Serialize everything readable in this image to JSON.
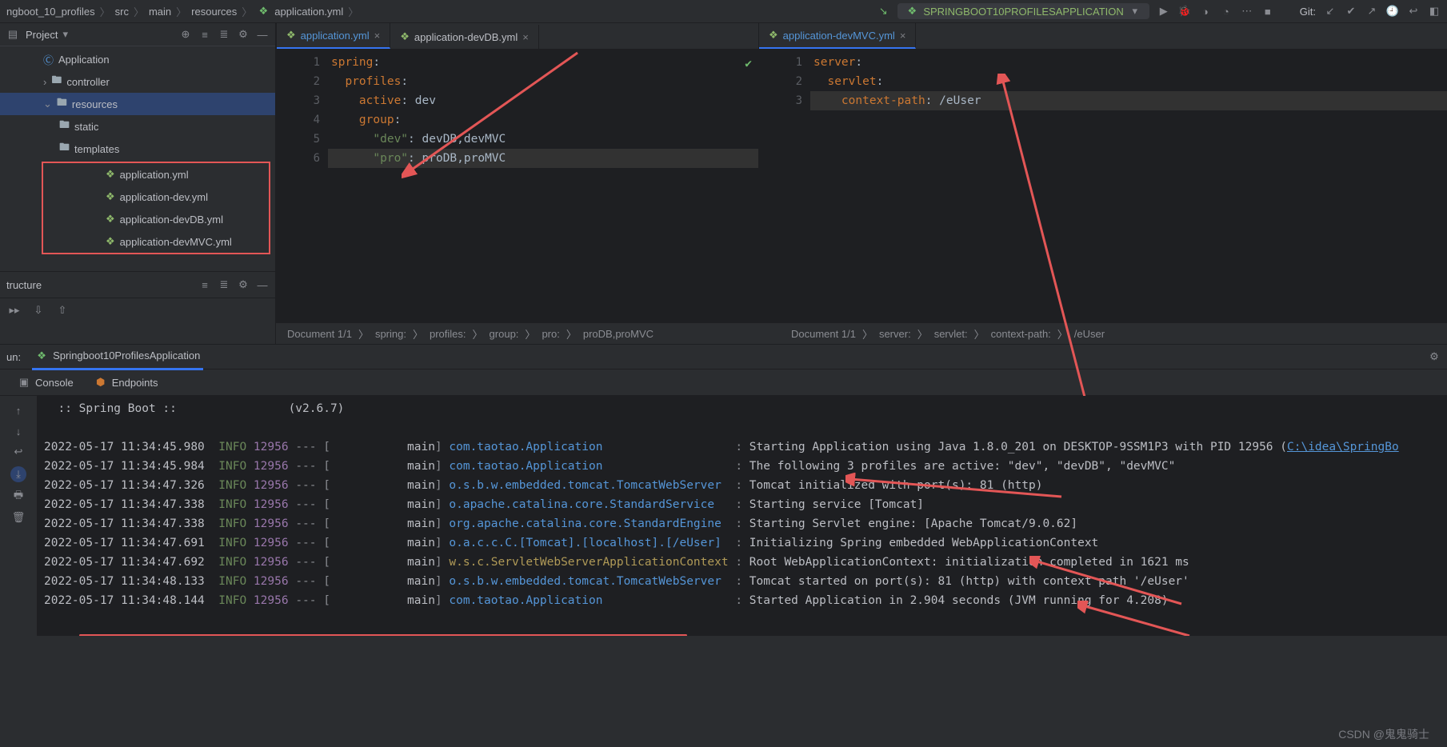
{
  "breadcrumbs": [
    "ngboot_10_profiles",
    "src",
    "main",
    "resources",
    "application.yml"
  ],
  "run_config": "SPRINGBOOT10PROFILESAPPLICATION",
  "git_label": "Git:",
  "project_panel": {
    "title": "Project",
    "items": [
      {
        "label": "Application",
        "level": "l1",
        "icon": "class",
        "sel": false
      },
      {
        "label": "controller",
        "level": "l1",
        "icon": "folder",
        "chev": "right",
        "sel": false
      },
      {
        "label": "resources",
        "level": "l1",
        "icon": "folder",
        "chev": "down",
        "sel": true
      },
      {
        "label": "static",
        "level": "l2",
        "icon": "folder",
        "sel": false
      },
      {
        "label": "templates",
        "level": "l2",
        "icon": "folder",
        "sel": false
      }
    ],
    "highlight_files": [
      {
        "label": "application.yml"
      },
      {
        "label": "application-dev.yml"
      },
      {
        "label": "application-devDB.yml"
      },
      {
        "label": "application-devMVC.yml"
      }
    ]
  },
  "structure_title": "tructure",
  "editor_left": {
    "tabs": [
      {
        "label": "application.yml",
        "active": true,
        "closeable": true
      },
      {
        "label": "application-devDB.yml",
        "active": false,
        "closeable": true
      }
    ],
    "gutter": [
      "1",
      "2",
      "3",
      "4",
      "5",
      "6"
    ],
    "code_lines": [
      {
        "segments": [
          {
            "t": "spring",
            "c": "k-key"
          },
          {
            "t": ":",
            "c": "k-plain"
          }
        ]
      },
      {
        "segments": [
          {
            "t": "  profiles",
            "c": "k-key"
          },
          {
            "t": ":",
            "c": "k-plain"
          }
        ]
      },
      {
        "segments": [
          {
            "t": "    active",
            "c": "k-key"
          },
          {
            "t": ": ",
            "c": "k-plain"
          },
          {
            "t": "dev",
            "c": "k-plain"
          }
        ]
      },
      {
        "segments": [
          {
            "t": "    group",
            "c": "k-key"
          },
          {
            "t": ":",
            "c": "k-plain"
          }
        ]
      },
      {
        "segments": [
          {
            "t": "      \"dev\"",
            "c": "k-str"
          },
          {
            "t": ": ",
            "c": "k-plain"
          },
          {
            "t": "devDB,devMVC",
            "c": "k-plain"
          }
        ]
      },
      {
        "segments": [
          {
            "t": "      \"pro\"",
            "c": "k-str"
          },
          {
            "t": ": ",
            "c": "k-plain"
          },
          {
            "t": "proDB,proMVC",
            "c": "k-plain"
          }
        ],
        "hl": true
      }
    ],
    "breadcrumb": [
      "Document 1/1",
      "spring:",
      "profiles:",
      "group:",
      "pro:",
      "proDB,proMVC"
    ]
  },
  "editor_right": {
    "tabs": [
      {
        "label": "application-devMVC.yml",
        "active": true,
        "closeable": true
      }
    ],
    "gutter": [
      "1",
      "2",
      "3"
    ],
    "code_lines": [
      {
        "segments": [
          {
            "t": "server",
            "c": "k-key"
          },
          {
            "t": ":",
            "c": "k-plain"
          }
        ]
      },
      {
        "segments": [
          {
            "t": "  servlet",
            "c": "k-key"
          },
          {
            "t": ":",
            "c": "k-plain"
          }
        ]
      },
      {
        "segments": [
          {
            "t": "    context-path",
            "c": "k-key"
          },
          {
            "t": ": ",
            "c": "k-plain"
          },
          {
            "t": "/eUser",
            "c": "k-plain"
          }
        ],
        "hl": true
      }
    ],
    "breadcrumb": [
      "Document 1/1",
      "server:",
      "servlet:",
      "context-path:",
      "/eUser"
    ]
  },
  "run_panel": {
    "run_tab_prefix": "un:",
    "run_tab": "Springboot10ProfilesApplication",
    "sub_tabs": [
      "Console",
      "Endpoints"
    ],
    "banner": {
      "label": ":: Spring Boot ::",
      "version": "(v2.6.7)"
    },
    "logs": [
      {
        "ts": "2022-05-17 11:34:45.980",
        "lvl": "INFO",
        "pid": "12956",
        "thread": "main",
        "cls": "com.taotao.Application",
        "clsColor": "log-cls",
        "msg": "Starting Application using Java 1.8.0_201 on DESKTOP-9SSM1P3 with PID 12956 (",
        "link": "C:\\idea\\SpringBo"
      },
      {
        "ts": "2022-05-17 11:34:45.984",
        "lvl": "INFO",
        "pid": "12956",
        "thread": "main",
        "cls": "com.taotao.Application",
        "clsColor": "log-cls",
        "msg": "The following 3 profiles are active: \"dev\", \"devDB\", \"devMVC\""
      },
      {
        "ts": "2022-05-17 11:34:47.326",
        "lvl": "INFO",
        "pid": "12956",
        "thread": "main",
        "cls": "o.s.b.w.embedded.tomcat.TomcatWebServer",
        "clsColor": "log-cls",
        "msg": "Tomcat initialized with port(s): 81 (http)"
      },
      {
        "ts": "2022-05-17 11:34:47.338",
        "lvl": "INFO",
        "pid": "12956",
        "thread": "main",
        "cls": "o.apache.catalina.core.StandardService",
        "clsColor": "log-cls",
        "msg": "Starting service [Tomcat]"
      },
      {
        "ts": "2022-05-17 11:34:47.338",
        "lvl": "INFO",
        "pid": "12956",
        "thread": "main",
        "cls": "org.apache.catalina.core.StandardEngine",
        "clsColor": "log-cls",
        "msg": "Starting Servlet engine: [Apache Tomcat/9.0.62]"
      },
      {
        "ts": "2022-05-17 11:34:47.691",
        "lvl": "INFO",
        "pid": "12956",
        "thread": "main",
        "cls": "o.a.c.c.C.[Tomcat].[localhost].[/eUser]",
        "clsColor": "log-cls",
        "msg": "Initializing Spring embedded WebApplicationContext"
      },
      {
        "ts": "2022-05-17 11:34:47.692",
        "lvl": "INFO",
        "pid": "12956",
        "thread": "main",
        "cls": "w.s.c.ServletWebServerApplicationContext",
        "clsColor": "log-cls2",
        "msg": "Root WebApplicationContext: initialization completed in 1621 ms"
      },
      {
        "ts": "2022-05-17 11:34:48.133",
        "lvl": "INFO",
        "pid": "12956",
        "thread": "main",
        "cls": "o.s.b.w.embedded.tomcat.TomcatWebServer",
        "clsColor": "log-cls",
        "msg": "Tomcat started on port(s): 81 (http) with context path '/eUser'"
      },
      {
        "ts": "2022-05-17 11:34:48.144",
        "lvl": "INFO",
        "pid": "12956",
        "thread": "main",
        "cls": "com.taotao.Application",
        "clsColor": "log-cls",
        "msg": "Started Application in 2.904 seconds (JVM running for 4.208)"
      }
    ]
  },
  "watermark": "CSDN @鬼鬼骑士"
}
